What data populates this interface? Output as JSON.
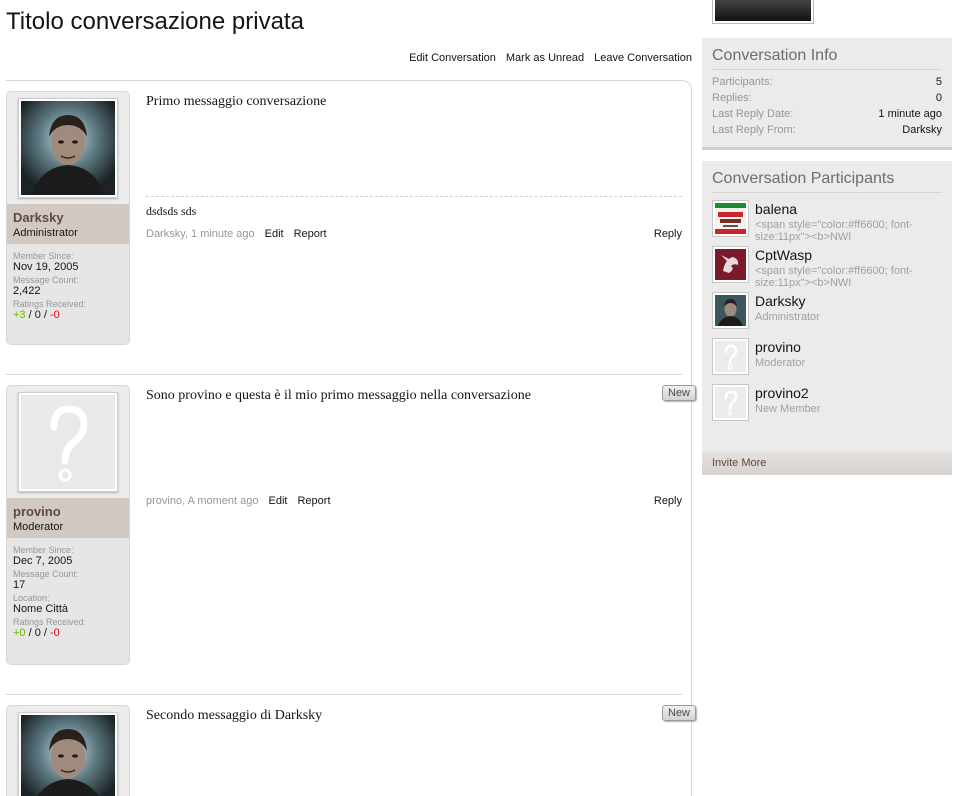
{
  "title": "Titolo conversazione privata",
  "controls": {
    "edit": "Edit Conversation",
    "mark_unread": "Mark as Unread",
    "leave": "Leave Conversation"
  },
  "messages": [
    {
      "user": {
        "name": "Darksky",
        "title": "Administrator",
        "member_since_label": "Member Since:",
        "member_since": "Nov 19, 2005",
        "message_count_label": "Message Count:",
        "message_count": "2,422",
        "ratings_label": "Ratings Received:",
        "ratings_pos": "+3",
        "ratings_neu": "0",
        "ratings_neg": "-0"
      },
      "text": "Primo messaggio conversazione",
      "signature": "dsdsds sds",
      "author_time": "Darksky, 1 minute ago",
      "edit": "Edit",
      "report": "Report",
      "reply": "Reply"
    },
    {
      "user": {
        "name": "provino",
        "title": "Moderator",
        "member_since_label": "Member Since:",
        "member_since": "Dec 7, 2005",
        "message_count_label": "Message Count:",
        "message_count": "17",
        "location_label": "Location:",
        "location": "Nome Città",
        "ratings_label": "Ratings Received:",
        "ratings_pos": "+0",
        "ratings_neu": "0",
        "ratings_neg": "-0"
      },
      "new_label": "New",
      "text": "Sono provino e questa è il mio primo messaggio nella conversazione",
      "author_time": "provino, A moment ago",
      "edit": "Edit",
      "report": "Report",
      "reply": "Reply"
    },
    {
      "new_label": "New",
      "text": "Secondo messaggio di Darksky"
    }
  ],
  "sidebar": {
    "info": {
      "title": "Conversation Info",
      "participants_label": "Participants:",
      "participants": "5",
      "replies_label": "Replies:",
      "replies": "0",
      "last_reply_date_label": "Last Reply Date:",
      "last_reply_date": "1 minute ago",
      "last_reply_from_label": "Last Reply From:",
      "last_reply_from": "Darksky"
    },
    "participants": {
      "title": "Conversation Participants",
      "list": [
        {
          "name": "balena",
          "title": "<span style=\"color:#ff6600; font-size:11px\"><b>NWI"
        },
        {
          "name": "CptWasp",
          "title": "<span style=\"color:#ff6600; font-size:11px\"><b>NWI"
        },
        {
          "name": "Darksky",
          "title": "Administrator"
        },
        {
          "name": "provino",
          "title": "Moderator"
        },
        {
          "name": "provino2",
          "title": "New Member"
        }
      ],
      "invite": "Invite More"
    }
  }
}
